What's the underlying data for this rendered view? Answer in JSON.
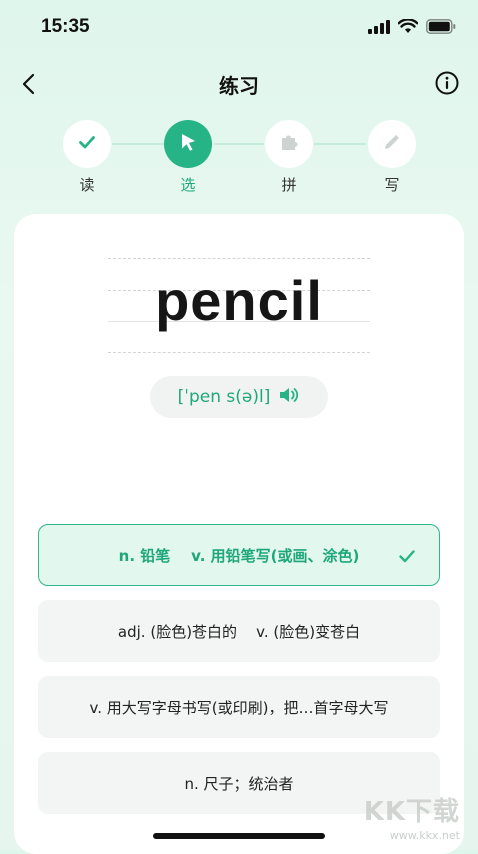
{
  "status_bar": {
    "time": "15:35"
  },
  "header": {
    "title": "练习"
  },
  "steps": [
    {
      "label": "读",
      "icon": "check-icon",
      "active": false
    },
    {
      "label": "选",
      "icon": "cursor-icon",
      "active": true
    },
    {
      "label": "拼",
      "icon": "puzzle-icon",
      "active": false
    },
    {
      "label": "写",
      "icon": "pencil-icon",
      "active": false
    }
  ],
  "word": {
    "text": "pencil",
    "phonetic": "[ˈpen s(ə)l]"
  },
  "options": [
    {
      "text": "n. 铅笔    v. 用铅笔写(或画、涂色)",
      "selected": true
    },
    {
      "text": "adj. (脸色)苍白的    v. (脸色)变苍白",
      "selected": false
    },
    {
      "text": "v. 用大写字母书写(或印刷)，把…首字母大写",
      "selected": false
    },
    {
      "text": "n. 尺子；统治者",
      "selected": false
    }
  ],
  "watermark": {
    "text": "KK下载",
    "url": "www.kkx.net"
  },
  "colors": {
    "accent": "#26b386",
    "accent_text": "#1fa77b",
    "selected_bg": "#e2f7ee",
    "option_bg": "#f3f4f4",
    "page_bg": "#e6f6ee"
  }
}
